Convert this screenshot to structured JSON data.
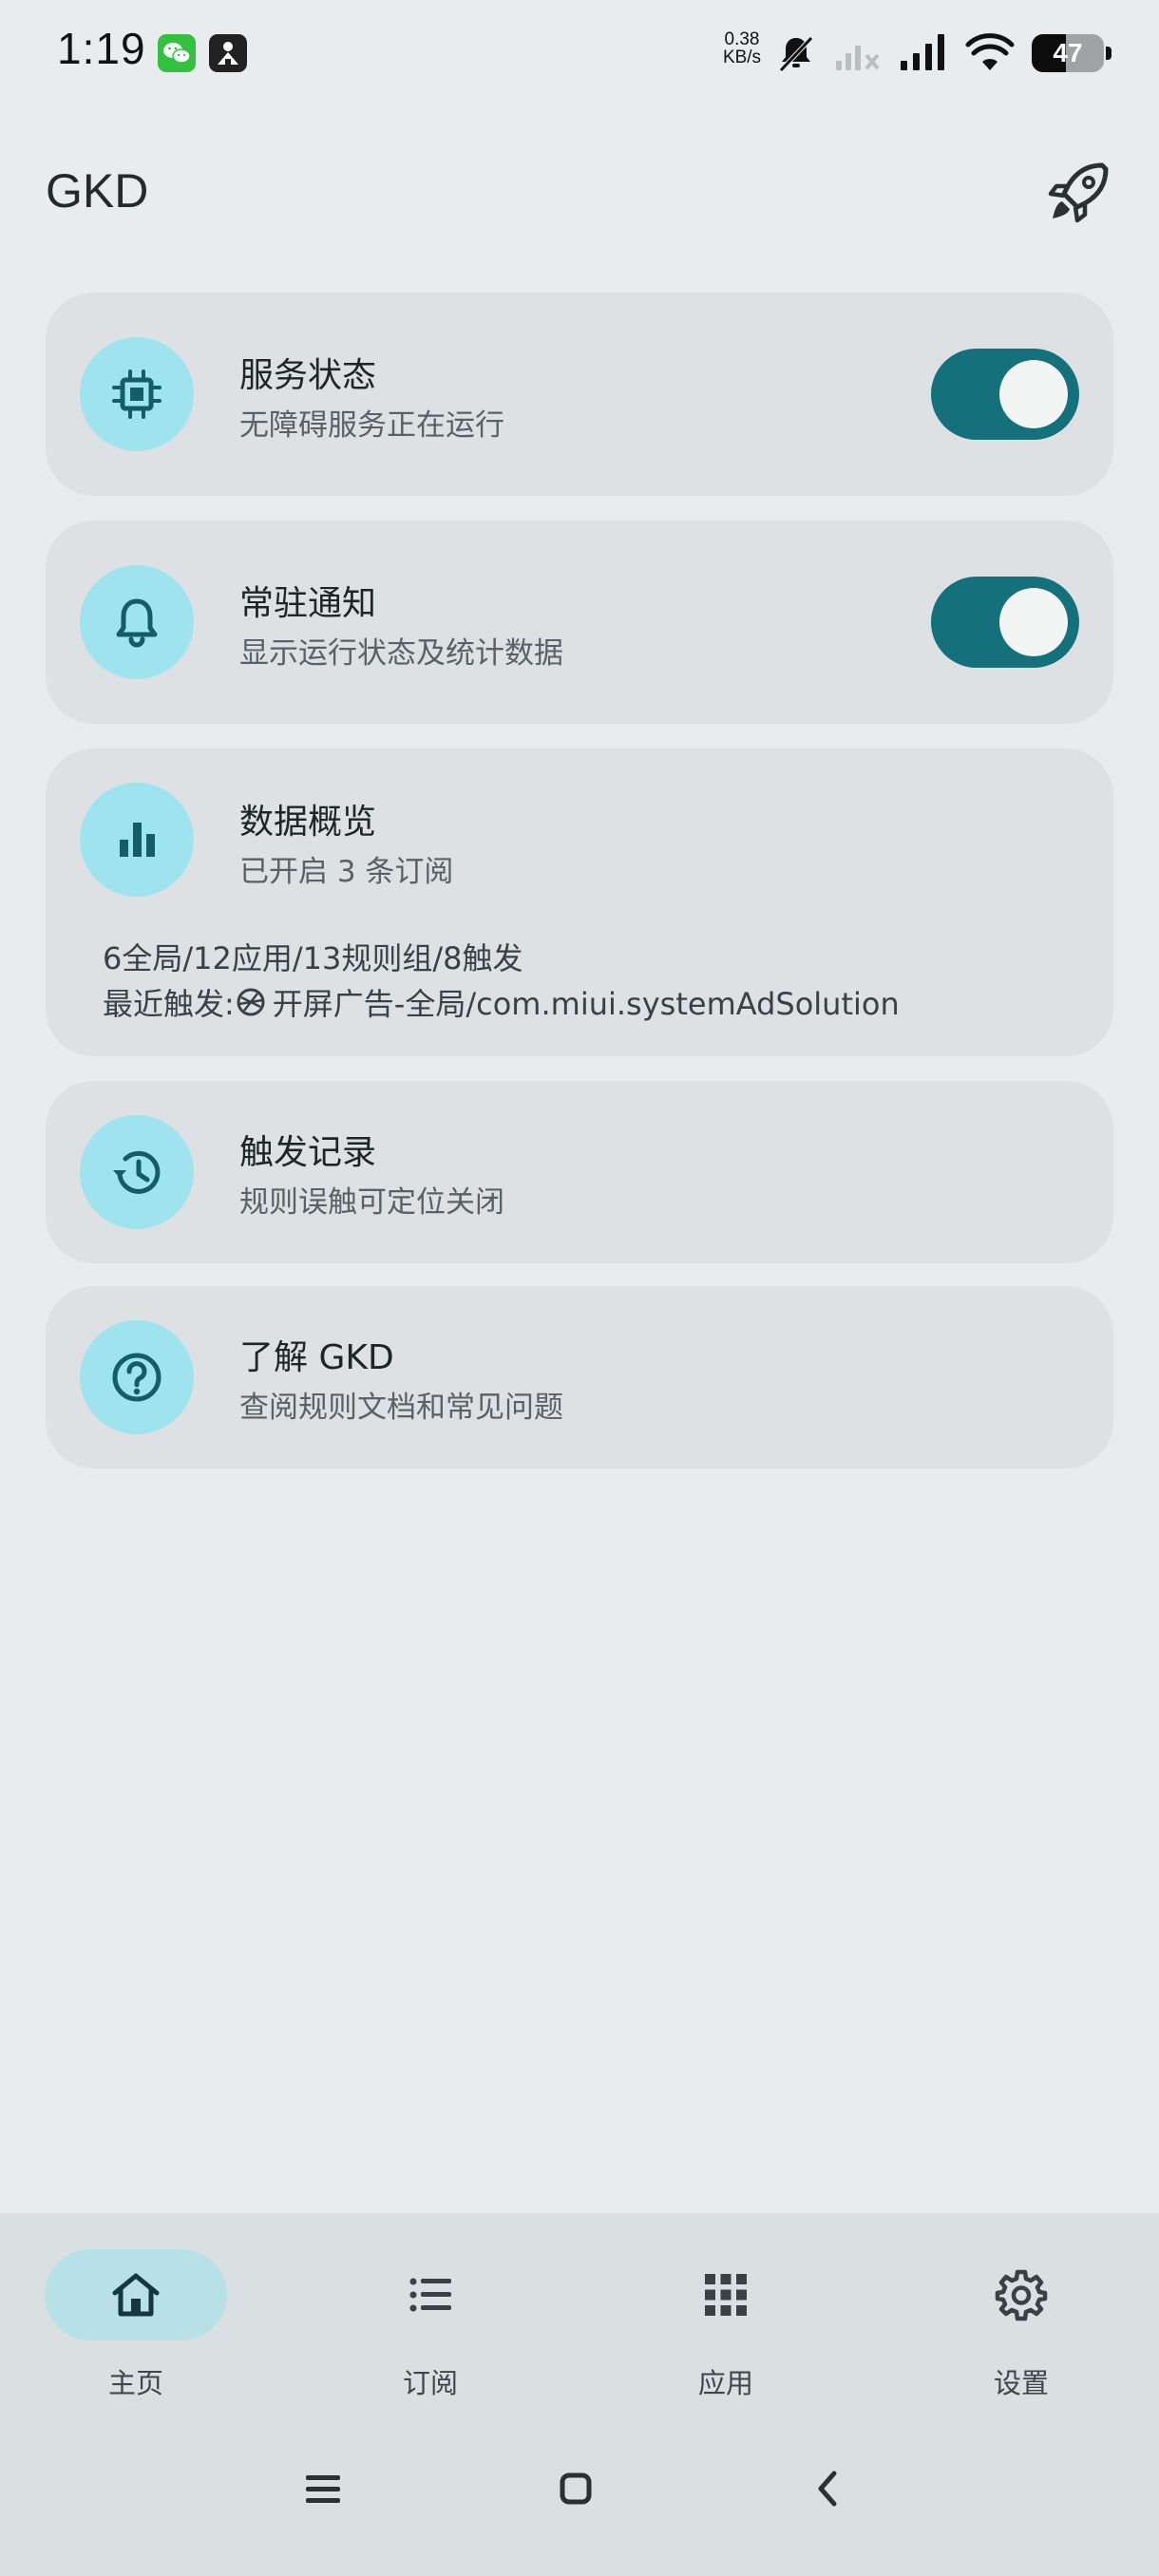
{
  "status_bar": {
    "time": "1:19",
    "net_speed_value": "0.38",
    "net_speed_unit": "KB/s",
    "battery_level": "47",
    "icons": [
      "wechat-icon",
      "app-notification-icon",
      "mute-icon",
      "signal-sim2-icon",
      "signal-icon",
      "wifi-icon",
      "battery-icon"
    ]
  },
  "header": {
    "title": "GKD",
    "action_icon": "rocket-icon"
  },
  "cards": {
    "service": {
      "title": "服务状态",
      "subtitle": "无障碍服务正在运行",
      "icon": "chip-icon",
      "enabled": true
    },
    "notification": {
      "title": "常驻通知",
      "subtitle": "显示运行状态及统计数据",
      "icon": "bell-icon",
      "enabled": true
    },
    "overview": {
      "title": "数据概览",
      "subtitle": "已开启 3 条订阅",
      "icon": "bar-chart-icon",
      "stats": "6全局/12应用/13规则组/8触发",
      "recent_prefix": "最近触发: ",
      "recent_value": "开屏广告-全局/com.miui.systemAdSolution",
      "recent_icon": "app-logo-icon"
    },
    "history": {
      "title": "触发记录",
      "subtitle": "规则误触可定位关闭",
      "icon": "history-icon"
    },
    "about": {
      "title": "了解 GKD",
      "subtitle": "查阅规则文档和常见问题",
      "icon": "help-icon"
    }
  },
  "bottom_nav": {
    "items": [
      {
        "label": "主页",
        "icon": "home-icon",
        "active": true
      },
      {
        "label": "订阅",
        "icon": "list-icon",
        "active": false
      },
      {
        "label": "应用",
        "icon": "apps-grid-icon",
        "active": false
      },
      {
        "label": "设置",
        "icon": "gear-icon",
        "active": false
      }
    ]
  },
  "colors": {
    "background": "#e8ecee",
    "card": "#dde1e3",
    "accent": "#14717c",
    "icon_circle": "#9fe3ee",
    "active_nav": "#b7e0e7"
  }
}
